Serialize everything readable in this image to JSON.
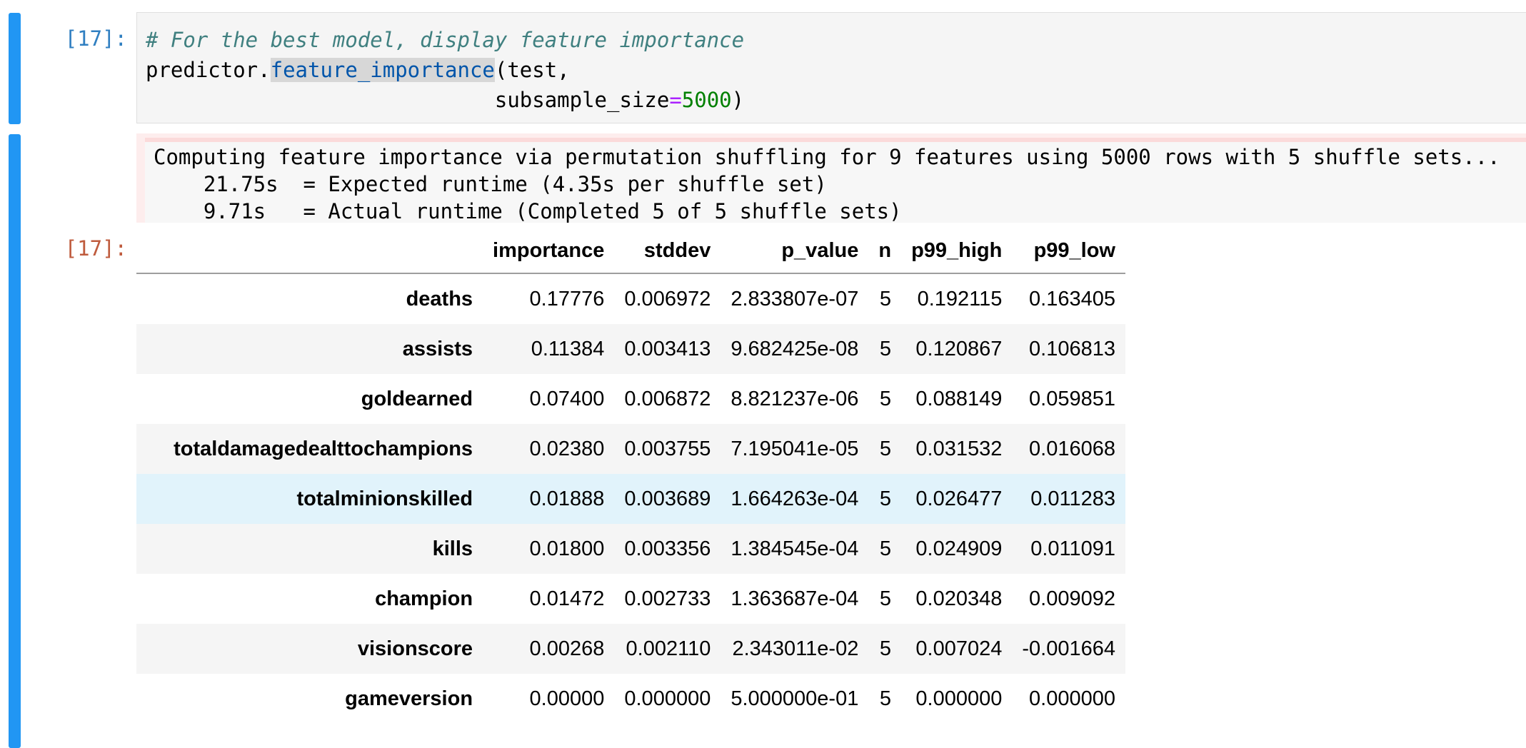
{
  "input_cell": {
    "prompt": "[17]:",
    "code": {
      "comment": "# For the best model, display feature importance",
      "obj": "predictor.",
      "method": "feature_importance",
      "args_line1": "(test,",
      "indent": "                            ",
      "kwarg": "subsample_size",
      "eq": "=",
      "num": "5000",
      "close": ")"
    }
  },
  "stderr": {
    "line1": "Computing feature importance via permutation shuffling for 9 features using 5000 rows with 5 shuffle sets...",
    "line2": "\t21.75s\t= Expected runtime (4.35s per shuffle set)",
    "line3": "\t9.71s\t= Actual runtime (Completed 5 of 5 shuffle sets)"
  },
  "output_cell": {
    "prompt": "[17]:",
    "table": {
      "columns": [
        "importance",
        "stddev",
        "p_value",
        "n",
        "p99_high",
        "p99_low"
      ],
      "rows": [
        {
          "index": "deaths",
          "values": [
            "0.17776",
            "0.006972",
            "2.833807e-07",
            "5",
            "0.192115",
            "0.163405"
          ]
        },
        {
          "index": "assists",
          "values": [
            "0.11384",
            "0.003413",
            "9.682425e-08",
            "5",
            "0.120867",
            "0.106813"
          ]
        },
        {
          "index": "goldearned",
          "values": [
            "0.07400",
            "0.006872",
            "8.821237e-06",
            "5",
            "0.088149",
            "0.059851"
          ]
        },
        {
          "index": "totaldamagedealttochampions",
          "values": [
            "0.02380",
            "0.003755",
            "7.195041e-05",
            "5",
            "0.031532",
            "0.016068"
          ]
        },
        {
          "index": "totalminionskilled",
          "values": [
            "0.01888",
            "0.003689",
            "1.664263e-04",
            "5",
            "0.026477",
            "0.011283"
          ]
        },
        {
          "index": "kills",
          "values": [
            "0.01800",
            "0.003356",
            "1.384545e-04",
            "5",
            "0.024909",
            "0.011091"
          ]
        },
        {
          "index": "champion",
          "values": [
            "0.01472",
            "0.002733",
            "1.363687e-04",
            "5",
            "0.020348",
            "0.009092"
          ]
        },
        {
          "index": "visionscore",
          "values": [
            "0.00268",
            "0.002110",
            "2.343011e-02",
            "5",
            "0.007024",
            "-0.001664"
          ]
        },
        {
          "index": "gameversion",
          "values": [
            "0.00000",
            "0.000000",
            "5.000000e-01",
            "5",
            "0.000000",
            "0.000000"
          ]
        }
      ]
    }
  },
  "colors": {
    "cell_bar": "#2196f3",
    "in_prompt": "#307fc1",
    "out_prompt": "#bf5b3d",
    "stderr_bg": "#fdeded",
    "row_hover": "#e1f3fb"
  }
}
